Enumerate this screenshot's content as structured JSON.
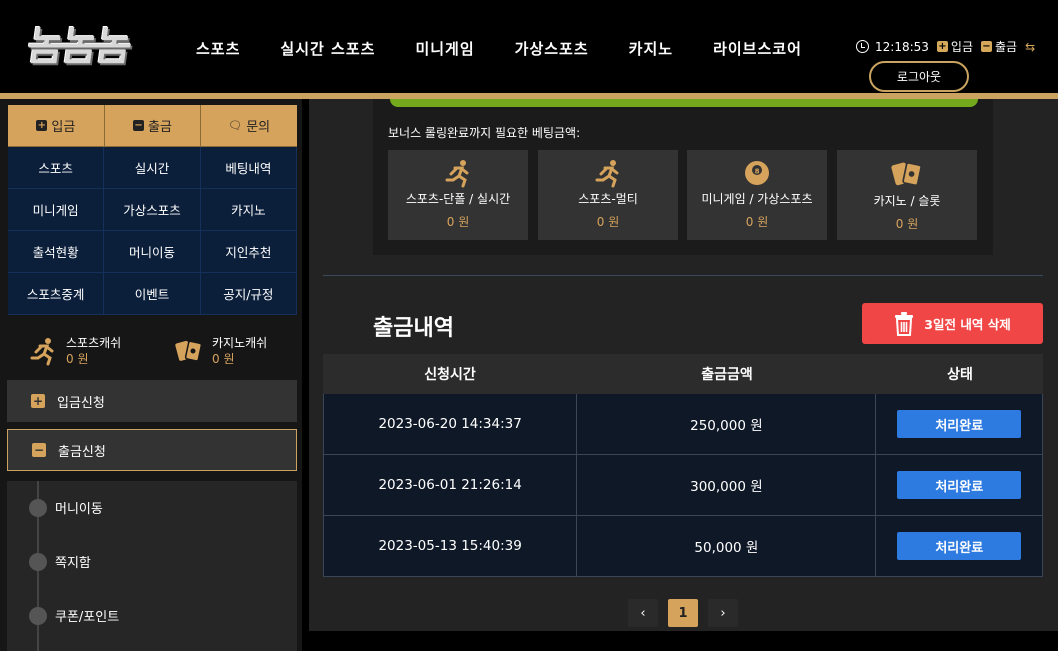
{
  "header": {
    "logo_text": "놈놈놈",
    "nav": [
      "스포츠",
      "실시간 스포츠",
      "미니게임",
      "가상스포츠",
      "카지노",
      "라이브스코어"
    ],
    "time": "12:18:53",
    "deposit_label": "입금",
    "withdraw_label": "출금",
    "logout_label": "로그아웃"
  },
  "sidebar": {
    "quick": [
      "입금",
      "출금",
      "문의"
    ],
    "menu": [
      "스포츠",
      "실시간",
      "베팅내역",
      "미니게임",
      "가상스포츠",
      "카지노",
      "출석현황",
      "머니이동",
      "지인추천",
      "스포츠중계",
      "이벤트",
      "공지/규정"
    ],
    "sports_cash_label": "스포츠캐쉬",
    "sports_cash_value": "0 원",
    "casino_cash_label": "카지노캐쉬",
    "casino_cash_value": "0 원",
    "deposit_request": "입금신청",
    "withdraw_request": "출금신청",
    "sub_items": [
      "머니이동",
      "쪽지함",
      "쿠폰/포인트"
    ]
  },
  "bonus": {
    "label": "보너스 롤링완료까지 필요한 베팅금액:",
    "cards": [
      {
        "title": "스포츠-단폴 / 실시간",
        "value": "0 원",
        "icon": "runner-icon"
      },
      {
        "title": "스포츠-멀티",
        "value": "0 원",
        "icon": "runner-icon"
      },
      {
        "title": "미니게임 / 가상스포츠",
        "value": "0 원",
        "icon": "ball-8-icon"
      },
      {
        "title": "카지노 / 슬롯",
        "value": "0 원",
        "icon": "cards-icon"
      }
    ]
  },
  "withdrawals": {
    "title": "출금내역",
    "delete_label": "3일전 내역 삭제",
    "columns": [
      "신청시간",
      "출금금액",
      "상태"
    ],
    "rows": [
      {
        "time": "2023-06-20 14:34:37",
        "amount": "250,000 원",
        "status": "처리완료"
      },
      {
        "time": "2023-06-01 21:26:14",
        "amount": "300,000 원",
        "status": "처리완료"
      },
      {
        "time": "2023-05-13 15:40:39",
        "amount": "50,000 원",
        "status": "처리완료"
      }
    ]
  },
  "pagination": {
    "current": "1",
    "prev": "‹",
    "next": "›"
  },
  "colors": {
    "accent": "#d6a35c",
    "delete": "#f14646",
    "status": "#2d7be0",
    "green": "#74a91e",
    "navy": "#0b1e3a"
  }
}
